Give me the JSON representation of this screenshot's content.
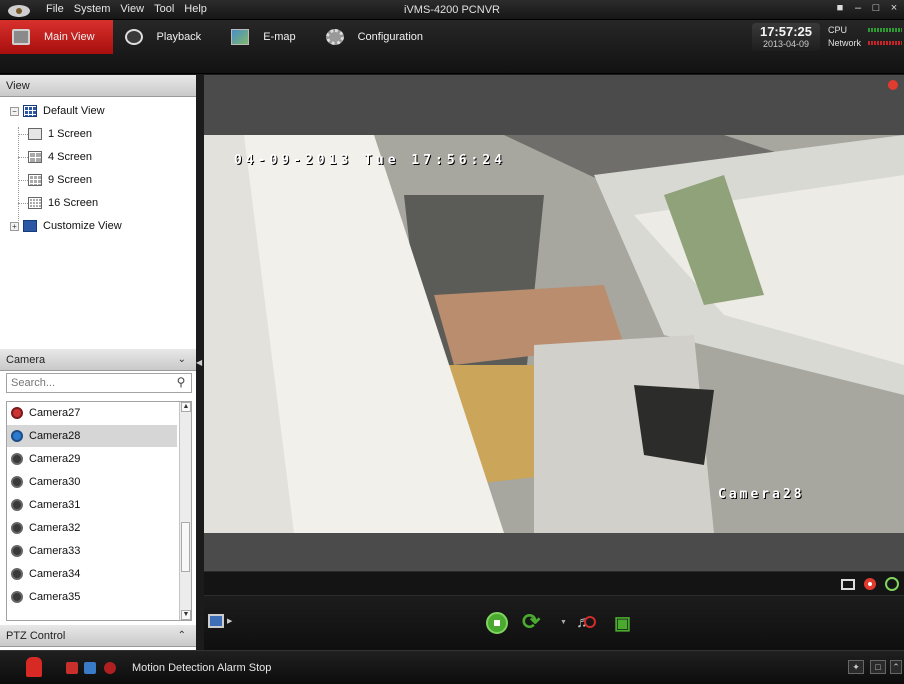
{
  "menu": {
    "items": [
      "File",
      "System",
      "View",
      "Tool",
      "Help"
    ]
  },
  "window": {
    "title": "iVMS-4200 PCNVR"
  },
  "tabs": [
    {
      "label": "Main View",
      "icon": "monitor-icon",
      "active": true
    },
    {
      "label": "Playback",
      "icon": "playback-icon",
      "active": false
    },
    {
      "label": "E-map",
      "icon": "emap-icon",
      "active": false
    },
    {
      "label": "Configuration",
      "icon": "gear-icon",
      "active": false
    }
  ],
  "clock": {
    "time": "17:57:25",
    "date": "2013-04-09"
  },
  "meters": {
    "cpu_label": "CPU",
    "network_label": "Network"
  },
  "view_panel": {
    "title": "View",
    "default_view": "Default View",
    "screens": [
      "1 Screen",
      "4 Screen",
      "9 Screen",
      "16 Screen"
    ],
    "customize_view": "Customize View"
  },
  "camera_panel": {
    "title": "Camera",
    "search_placeholder": "Search...",
    "cameras": [
      "Camera27",
      "Camera28",
      "Camera29",
      "Camera30",
      "Camera31",
      "Camera32",
      "Camera33",
      "Camera34",
      "Camera35"
    ],
    "selected": "Camera28"
  },
  "ptz_panel": {
    "title": "PTZ Control"
  },
  "video": {
    "osd_datetime": "04-09-2013 Tue 17:56:24",
    "osd_camera": "Camera28"
  },
  "status": {
    "message": "Motion Detection Alarm Stop"
  },
  "colors": {
    "accent_red": "#c8201d",
    "accent_green": "#4aaa2f",
    "selection": "#d6d6d6"
  }
}
